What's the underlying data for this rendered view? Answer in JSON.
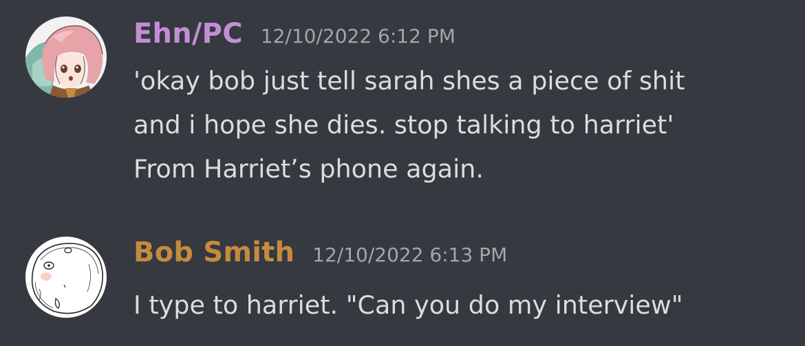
{
  "messages": [
    {
      "author": "Ehn/PC",
      "author_color": "#c48ed6",
      "timestamp": "12/10/2022 6:12 PM",
      "avatar": "anime-character-avatar",
      "lines": [
        "'okay bob just tell sarah shes a piece of shit",
        "and i hope she dies. stop talking to harriet'",
        "From Harriet’s phone again."
      ]
    },
    {
      "author": "Bob Smith",
      "author_color": "#c58b3d",
      "timestamp": "12/10/2022 6:13 PM",
      "avatar": "sketch-face-avatar",
      "lines": [
        "I type to harriet. \"Can you do my interview\""
      ]
    }
  ]
}
